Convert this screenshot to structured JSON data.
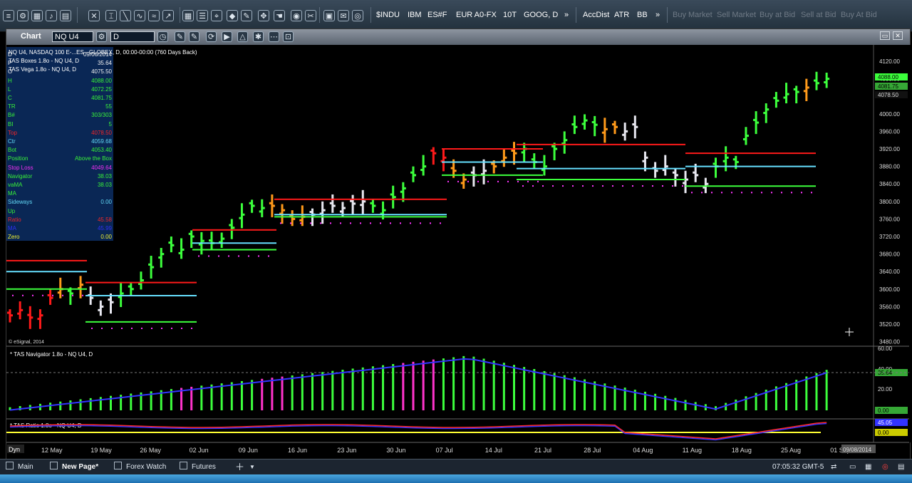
{
  "toolbar": {
    "symbols": [
      "$INDU",
      "IBM",
      "ES#F",
      "EUR A0-FX",
      "10T",
      "GOOG, D",
      "»",
      "AccDist",
      "ATR",
      "BB",
      "»"
    ],
    "dim_labels": [
      "Buy Market",
      "Sell Market",
      "Buy at Bid",
      "Sell at Bid",
      "Buy At Bid"
    ]
  },
  "window": {
    "title": "Chart",
    "symbol_value": "NQ U4",
    "interval_value": "D",
    "tool_icons": [
      "pencil-icon",
      "pencil-icon",
      "refresh-icon",
      "play-icon",
      "triangle-icon",
      "wrench-icon",
      "ellipsis-icon",
      "link-icon"
    ]
  },
  "chart_info": {
    "line1": "NQ U4, NASDAQ 100 E-...ES - GLOBEX, D, 00:00-00:00 (760 Days Back)",
    "line1_date": "09/09/2014",
    "line2": "TAS Boxes 1.8o - NQ U4, D",
    "line3": "TAS Vega 1.8o - NQ U4, D",
    "watermark": "© eSignal, 2014"
  },
  "legend": [
    {
      "name": "D",
      "value": "09/06/2014",
      "color": "#ffffff"
    },
    {
      "name": "P",
      "value": "35.64",
      "color": "#ffffff"
    },
    {
      "name": "O",
      "value": "4075.50",
      "color": "#ffffff"
    },
    {
      "name": "H",
      "value": "4088.00",
      "color": "#3cff3c"
    },
    {
      "name": "L",
      "value": "4072.25",
      "color": "#3cff3c"
    },
    {
      "name": "C",
      "value": "4081.75",
      "color": "#3cff3c"
    },
    {
      "name": "TR",
      "value": "55",
      "color": "#3cff3c"
    },
    {
      "name": "B#",
      "value": "303/303",
      "color": "#3cff3c"
    },
    {
      "name": "BI",
      "value": "5",
      "color": "#3cff3c"
    },
    {
      "name": "Top",
      "value": "4078.50",
      "color": "#ff2a2a"
    },
    {
      "name": "Ctr",
      "value": "4059.68",
      "color": "#66e0ff"
    },
    {
      "name": "Bot",
      "value": "4053.40",
      "color": "#3cff3c"
    },
    {
      "name": "Position",
      "value": "Above the Box",
      "color": "#3cff3c"
    },
    {
      "name": "Stop Loss",
      "value": "4049.64",
      "color": "#ff33ff"
    },
    {
      "name": "Navigator",
      "value": "38.03",
      "color": "#3cff3c"
    },
    {
      "name": "vaMA",
      "value": "38.03",
      "color": "#3cff3c"
    },
    {
      "name": "MA",
      "value": "",
      "color": "#3cff3c"
    },
    {
      "name": "Sideways",
      "value": "0.00",
      "color": "#66e0ff"
    },
    {
      "name": "Up",
      "value": "",
      "color": "#3cff3c"
    },
    {
      "name": "Ratio",
      "value": "45.58",
      "color": "#ff2a2a"
    },
    {
      "name": "MA",
      "value": "45.99",
      "color": "#3333ff"
    },
    {
      "name": "Zero",
      "value": "0.00",
      "color": "#ffff33"
    }
  ],
  "panes": {
    "price_axis_labels": [
      "4120.00",
      "4080.00",
      "4040.00",
      "4000.00",
      "3960.00",
      "3920.00",
      "3880.00",
      "3840.00",
      "3800.00",
      "3760.00",
      "3720.00",
      "3680.00",
      "3640.00",
      "3600.00",
      "3560.00",
      "3520.00",
      "3480.00"
    ],
    "price_markers": [
      "4088.00",
      "4081.75",
      "4078.50"
    ],
    "navigator_title": "* TAS Navigator 1.8o - NQ U4, D",
    "navigator_axis": [
      "60.00",
      "40.00",
      "20.00"
    ],
    "navigator_markers": [
      "35.64",
      "0.00"
    ],
    "ratio_title": "* TAS Ratio 1.8o - NQ U4, D",
    "ratio_markers": [
      "45.05",
      "0.00"
    ],
    "date_labels": [
      "12 May",
      "19 May",
      "26 May",
      "02 Jun",
      "09 Jun",
      "16 Jun",
      "23 Jun",
      "30 Jun",
      "07 Jul",
      "14 Jul",
      "21 Jul",
      "28 Jul",
      "04 Aug",
      "11 Aug",
      "18 Aug",
      "25 Aug",
      "01 Sep"
    ],
    "cursor_date": "09/08/2014",
    "dyn_label": "Dyn"
  },
  "tabs": [
    {
      "label": "Main"
    },
    {
      "label": "New Page*"
    },
    {
      "label": "Forex Watch"
    },
    {
      "label": "Futures"
    }
  ],
  "status": {
    "time": "07:05:32",
    "tz": "GMT-5"
  },
  "colors": {
    "up": "#3cff3c",
    "down": "#ff1a1a",
    "neutral": "#e8e8f0",
    "turn": "#ff9a1a",
    "box_top": "#ff1a1a",
    "box_ctr": "#66e0ff",
    "box_bot": "#3cff3c",
    "stop": "#ff33ff",
    "nav_ma": "#3333ff",
    "ratio": "#ff2a2a",
    "zero": "#ffff33"
  }
}
